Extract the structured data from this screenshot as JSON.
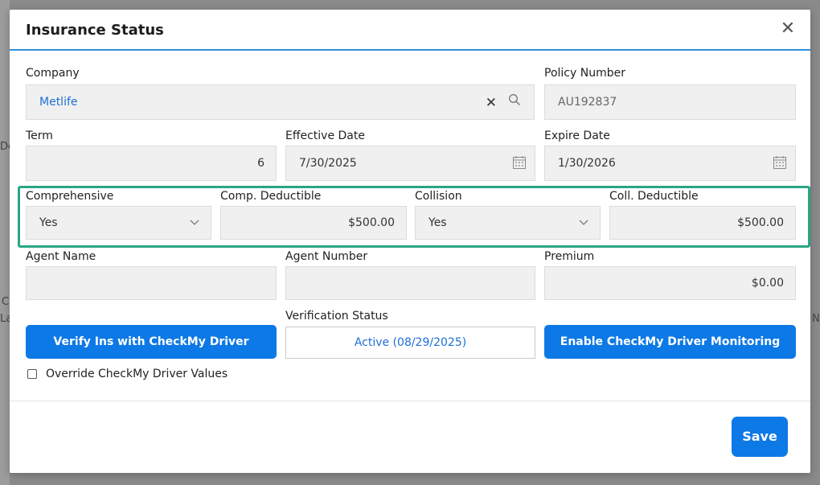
{
  "background": {
    "hint_chars": [
      "De",
      "L",
      "La",
      "N",
      "C"
    ]
  },
  "dialog": {
    "title": "Insurance Status",
    "close_label": "✕"
  },
  "company": {
    "label": "Company",
    "value": "Metlife",
    "clear_glyph": "✕"
  },
  "policy_number": {
    "label": "Policy Number",
    "value": "AU192837"
  },
  "term": {
    "label": "Term",
    "value": "6"
  },
  "effective_date": {
    "label": "Effective Date",
    "value": "7/30/2025"
  },
  "expire_date": {
    "label": "Expire Date",
    "value": "1/30/2026"
  },
  "comprehensive": {
    "label": "Comprehensive",
    "value": "Yes"
  },
  "comp_deductible": {
    "label": "Comp. Deductible",
    "value": "$500.00"
  },
  "collision": {
    "label": "Collision",
    "value": "Yes"
  },
  "coll_deductible": {
    "label": "Coll. Deductible",
    "value": "$500.00"
  },
  "agent_name": {
    "label": "Agent Name",
    "value": ""
  },
  "agent_number": {
    "label": "Agent Number",
    "value": ""
  },
  "premium": {
    "label": "Premium",
    "value": "$0.00"
  },
  "verification": {
    "label": "Verification Status",
    "value": "Active (08/29/2025)"
  },
  "buttons": {
    "verify": "Verify Ins with CheckMy Driver",
    "enable_monitoring": "Enable CheckMy Driver Monitoring",
    "save": "Save"
  },
  "override": {
    "label": "Override CheckMy Driver Values",
    "checked": false
  },
  "colors": {
    "primary": "#0d79e6",
    "highlight": "#2aa584",
    "header_rule": "#2f8fd6",
    "link": "#1f6fd6"
  }
}
